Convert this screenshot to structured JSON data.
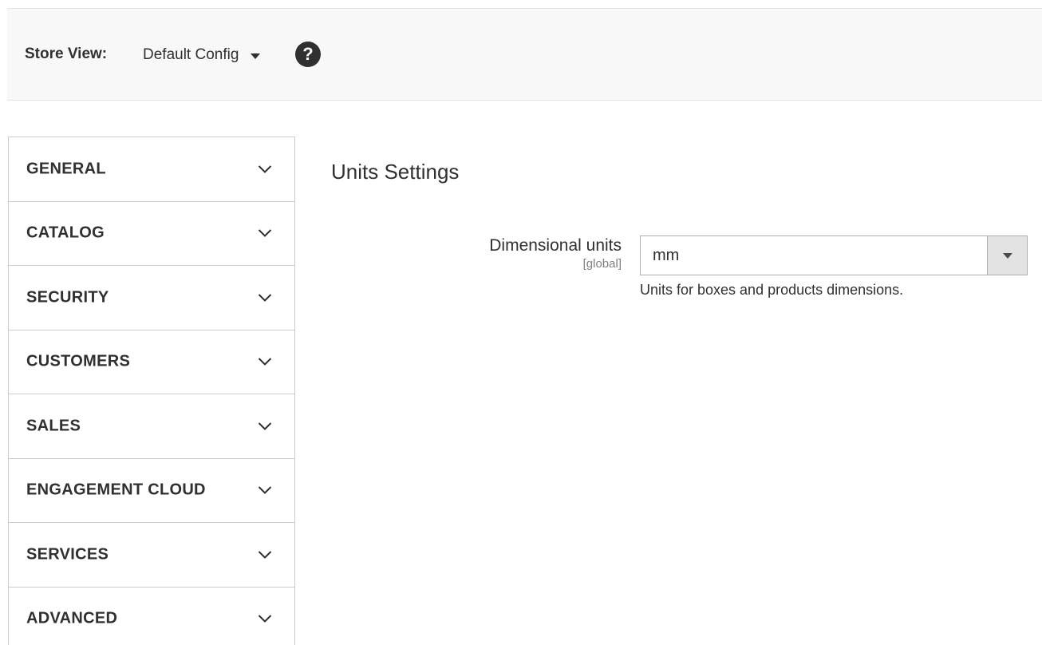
{
  "store_bar": {
    "label": "Store View:",
    "value": "Default Config",
    "help_icon": "question-circle-icon",
    "help_glyph": "?"
  },
  "sidebar": {
    "items": [
      {
        "label": "GENERAL",
        "icon": "chevron-down-icon"
      },
      {
        "label": "CATALOG",
        "icon": "chevron-down-icon"
      },
      {
        "label": "SECURITY",
        "icon": "chevron-down-icon"
      },
      {
        "label": "CUSTOMERS",
        "icon": "chevron-down-icon"
      },
      {
        "label": "SALES",
        "icon": "chevron-down-icon"
      },
      {
        "label": "ENGAGEMENT CLOUD",
        "icon": "chevron-down-icon"
      },
      {
        "label": "SERVICES",
        "icon": "chevron-down-icon"
      },
      {
        "label": "ADVANCED",
        "icon": "chevron-down-icon"
      }
    ]
  },
  "main": {
    "section_title": "Units Settings",
    "field": {
      "label": "Dimensional units",
      "scope": "[global]",
      "value": "mm",
      "note": "Units for boxes and products dimensions."
    }
  },
  "colors": {
    "text": "#303030",
    "bar_background": "#f8f8f8",
    "border": "#cccccc",
    "select_button": "#e3e3e3"
  }
}
